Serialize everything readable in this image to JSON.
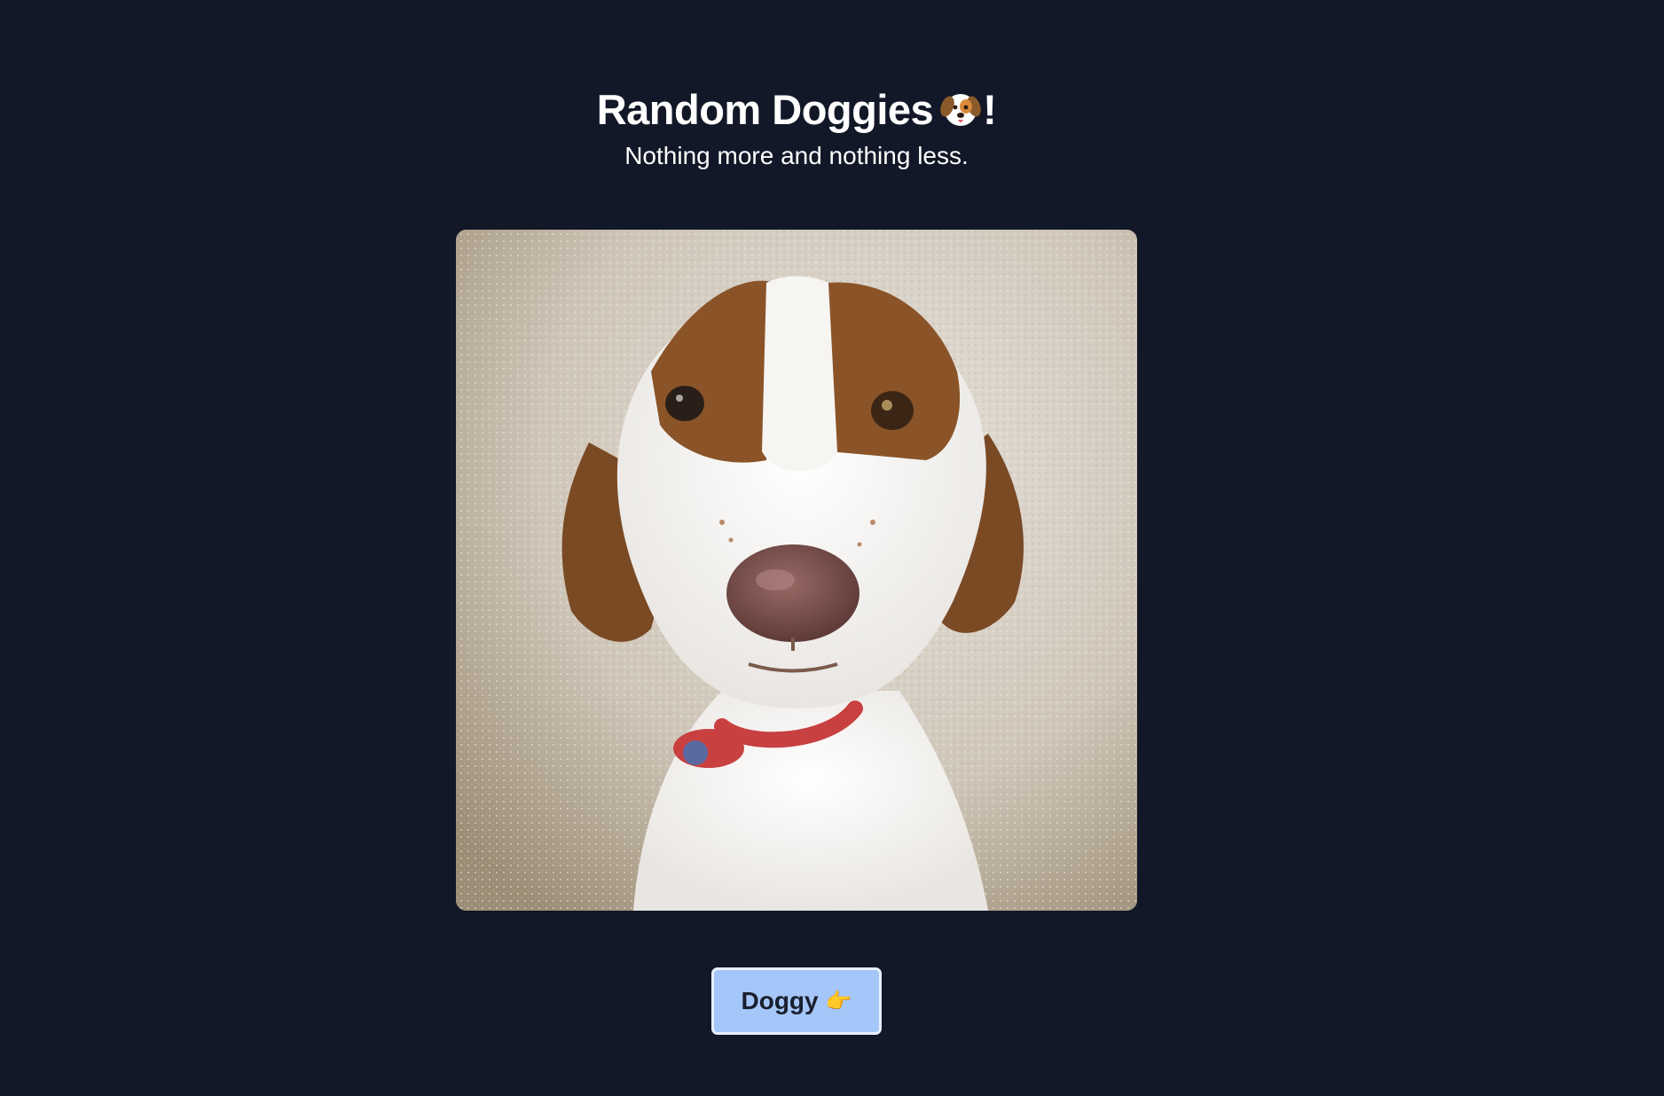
{
  "header": {
    "title": "Random Doggies",
    "title_suffix": "!",
    "subtitle": "Nothing more and nothing less."
  },
  "image": {
    "alt": "Random dog photo",
    "icon": "dog-photo"
  },
  "button": {
    "label": "Doggy",
    "icon": "pointing-hand-icon",
    "glyph": "👉"
  },
  "colors": {
    "background": "#121827",
    "button_bg": "#a5c6f8",
    "button_border": "#e8eefc",
    "text": "#ffffff"
  }
}
